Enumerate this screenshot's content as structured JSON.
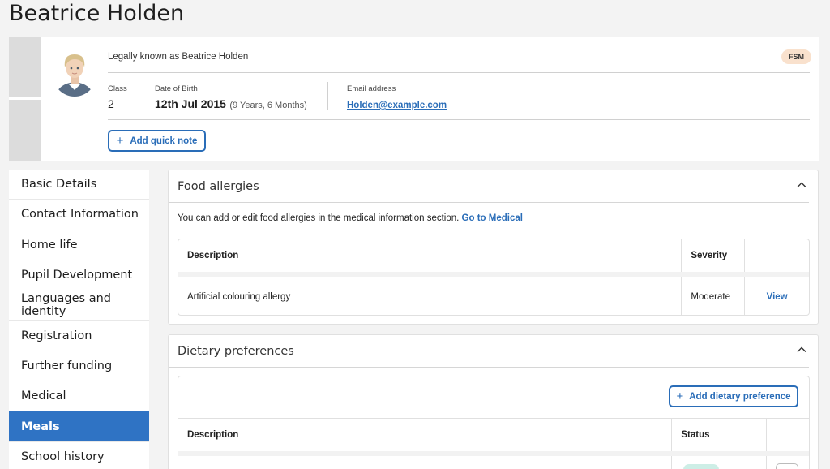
{
  "page": {
    "title": "Beatrice Holden"
  },
  "header": {
    "legal_name": "Legally known as Beatrice Holden",
    "badge": "FSM",
    "class_label": "Class",
    "class_value": "2",
    "dob_label": "Date of Birth",
    "dob_value": "12th Jul 2015",
    "dob_age": "(9 Years, 6 Months)",
    "email_label": "Email address",
    "email_value": "Holden@example.com",
    "quick_note_label": "Add quick note"
  },
  "sidebar": {
    "items": [
      {
        "label": "Basic Details"
      },
      {
        "label": "Contact Information"
      },
      {
        "label": "Home life"
      },
      {
        "label": "Pupil Development"
      },
      {
        "label": "Languages and identity"
      },
      {
        "label": "Registration"
      },
      {
        "label": "Further funding"
      },
      {
        "label": "Medical"
      },
      {
        "label": "Meals"
      },
      {
        "label": "School history"
      }
    ],
    "active_index": 8
  },
  "food_allergies": {
    "title": "Food allergies",
    "note": "You can add or edit food allergies in the medical information section.",
    "note_link": "Go to Medical",
    "columns": [
      "Description",
      "Severity",
      ""
    ],
    "rows": [
      {
        "description": "Artificial colouring allergy",
        "severity": "Moderate",
        "action": "View"
      }
    ]
  },
  "dietary_preferences": {
    "title": "Dietary preferences",
    "add_label": "Add dietary preference",
    "columns": [
      "Description",
      "Status",
      ""
    ]
  },
  "colors": {
    "accent": "#2f73c4",
    "link": "#2a6db8",
    "badge_bg": "#f9e1cd"
  }
}
